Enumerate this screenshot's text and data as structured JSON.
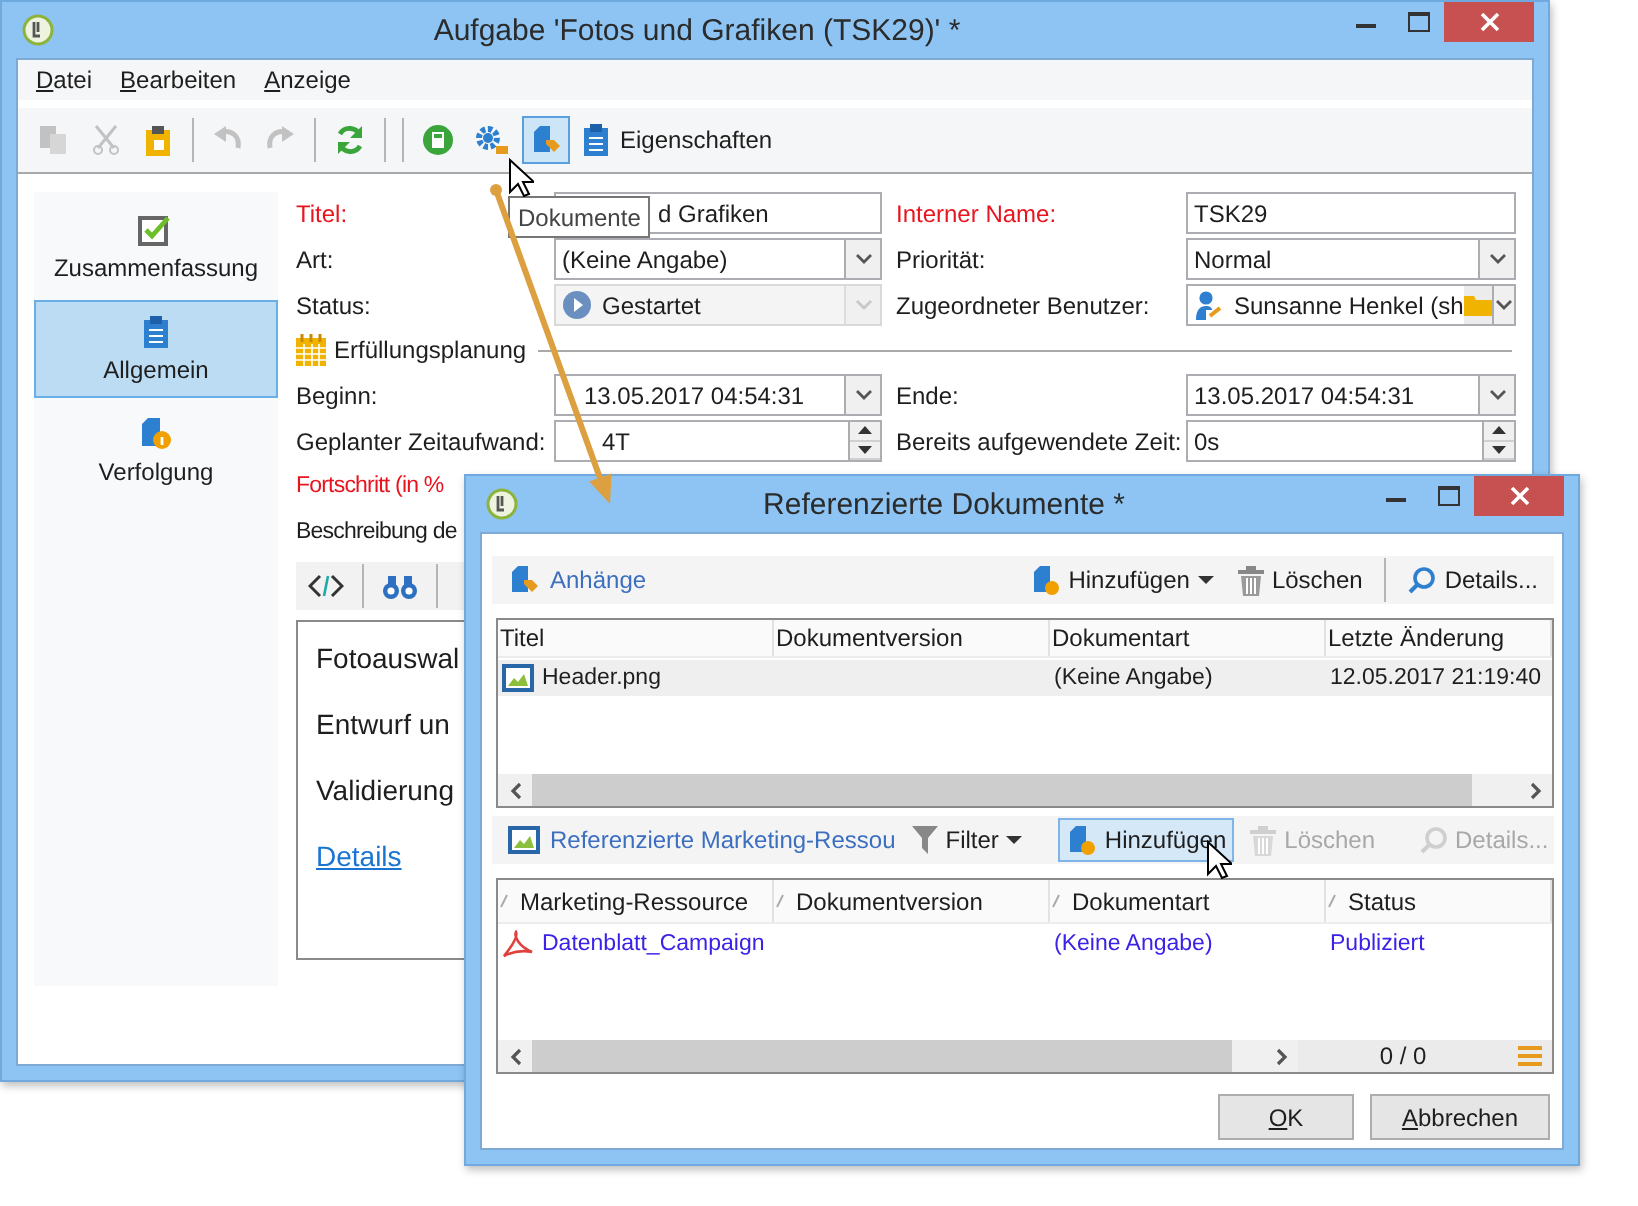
{
  "window": {
    "title": "Aufgabe 'Fotos und Grafiken (TSK29)' *"
  },
  "menu": [
    "Datei",
    "Bearbeiten",
    "Anzeige"
  ],
  "toolbar": [
    {
      "disabled": true,
      "selected": false
    },
    {
      "disabled": true,
      "selected": false
    },
    {
      "disabled": false,
      "selected": false
    },
    {
      "disabled": true,
      "selected": false
    },
    {
      "disabled": true,
      "selected": false
    },
    {
      "disabled": false,
      "selected": false
    },
    {
      "disabled": false,
      "selected": false
    },
    {
      "disabled": false,
      "selected": false
    },
    {
      "disabled": false,
      "selected": true
    },
    {
      "disabled": false,
      "selected": false,
      "label": "Eigenschaften"
    }
  ],
  "tooltip": "Dokumente",
  "nav": [
    {
      "label": "Zusammenfassung",
      "selected": false
    },
    {
      "label": "Allgemein",
      "selected": true
    },
    {
      "label": "Verfolgung",
      "selected": false
    }
  ],
  "form": {
    "rows": [
      [
        {
          "label": "Titel:",
          "required": true,
          "kind": "text",
          "value": "d Grafiken",
          "disabled": false
        },
        {
          "label": "Interner Name:",
          "required": true,
          "kind": "text",
          "value": "TSK29",
          "disabled": false
        }
      ],
      [
        {
          "label": "Art:",
          "required": false,
          "kind": "select",
          "value": "(Keine Angabe)",
          "disabled": false
        },
        {
          "label": "Priorität:",
          "required": false,
          "kind": "select",
          "value": "Normal",
          "disabled": false
        }
      ],
      [
        {
          "label": "Status:",
          "required": false,
          "kind": "status",
          "value": "Gestartet",
          "disabled": true
        },
        {
          "label": "Zugeordneter Benutzer:",
          "required": false,
          "kind": "user",
          "value": "Sunsanne Henkel (sh",
          "disabled": false
        }
      ]
    ],
    "section": "Erfüllungsplanung",
    "planning_rows": [
      [
        {
          "label": "Beginn:",
          "required": false,
          "kind": "date",
          "value": "13.05.2017 04:54:31",
          "disabled": false
        },
        {
          "label": "Ende:",
          "required": false,
          "kind": "date",
          "value": "13.05.2017 04:54:31",
          "disabled": false
        }
      ],
      [
        {
          "label": "Geplanter Zeitaufwand:",
          "required": false,
          "kind": "spin",
          "value": "4T",
          "disabled": false
        },
        {
          "label": "Bereits aufgewendete Zeit:",
          "required": false,
          "kind": "spin",
          "value": "0s",
          "disabled": false
        }
      ]
    ],
    "labels": [
      {
        "text": "Fortschritt (in %",
        "required": true
      },
      {
        "text": "Beschreibung de",
        "required": false
      }
    ],
    "editor": {
      "lines": [
        "Fotoauswal",
        "Entwurf un",
        "Validierung"
      ],
      "link": "Details"
    }
  },
  "dialog": {
    "title": "Referenzierte Dokumente *",
    "tables": [
      {
        "title": "Anhänge",
        "actions": [
          {
            "label": "Hinzufügen",
            "dropdown": true,
            "disabled": false,
            "selected": false
          },
          {
            "label": "Löschen",
            "dropdown": false,
            "disabled": false,
            "selected": false
          },
          {
            "label": "Details...",
            "dropdown": false,
            "disabled": false,
            "selected": false
          }
        ],
        "columns": [
          "Titel",
          "Dokumentversion",
          "Dokumentart",
          "Letzte Änderung"
        ],
        "rows": [
          {
            "cells": [
              "Header.png",
              null,
              "(Keine Angabe)",
              "12.05.2017 21:19:40"
            ],
            "selected": true
          }
        ]
      },
      {
        "title": "Referenzierte Marketing-Ressou",
        "filter": "Filter",
        "sort_indicators": true,
        "actions": [
          {
            "label": "Hinzufügen",
            "dropdown": false,
            "disabled": false,
            "selected": true
          },
          {
            "label": "Löschen",
            "dropdown": false,
            "disabled": true,
            "selected": false
          },
          {
            "label": "Details...",
            "dropdown": false,
            "disabled": true,
            "selected": false
          }
        ],
        "columns": [
          "Marketing-Ressource",
          "Dokumentversion",
          "Dokumentart",
          "Status"
        ],
        "rows": [
          {
            "cells": [
              "Datenblatt_Campaign",
              null,
              "(Keine Angabe)",
              "Publiziert"
            ],
            "selected": false
          }
        ],
        "counter": "0 / 0"
      }
    ],
    "buttons": [
      "OK",
      "Abbrechen"
    ]
  }
}
